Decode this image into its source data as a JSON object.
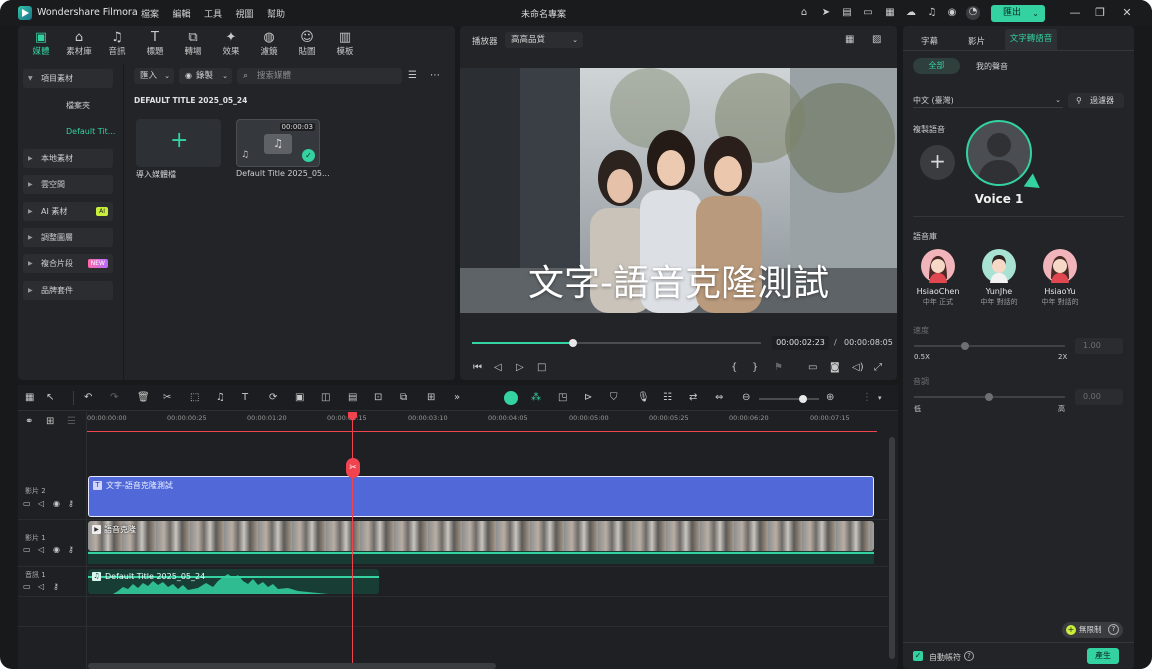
{
  "app": {
    "name": "Wondershare Filmora",
    "document_title": "未命名專案"
  },
  "menu": [
    "檔案",
    "編輯",
    "工具",
    "視圖",
    "幫助"
  ],
  "export_label": "匯出",
  "media_tabs": [
    "媒體",
    "素材庫",
    "音訊",
    "標題",
    "轉場",
    "效果",
    "濾鏡",
    "貼圖",
    "模板"
  ],
  "sidebar": {
    "items": [
      "項目素材",
      "本地素材",
      "雲空間",
      "AI 素材",
      "調整圖層",
      "複合片段",
      "品牌套件"
    ],
    "sub_items": [
      "檔案夾",
      "Default Tit..."
    ],
    "ai_badge": "AI",
    "new_badge": "NEW"
  },
  "media": {
    "import_label": "匯入",
    "record_label": "錄製",
    "search_placeholder": "搜索媒體",
    "section_title": "DEFAULT TITLE 2025_05_24",
    "import_media_label": "導入媒體檔",
    "clip_name": "Default Title 2025_05...",
    "clip_duration": "00:00:03"
  },
  "player": {
    "label": "播放器",
    "quality": "高高品質",
    "overlay_text": "文字-語音克隆測試",
    "current_time": "00:00:02:23",
    "total_time": "00:00:08:05",
    "progress": 0.35
  },
  "right_panel": {
    "tabs": [
      "字幕",
      "影片",
      "文字轉語音"
    ],
    "subtabs": [
      "全部",
      "我的聲音"
    ],
    "language": "中文 (臺灣)",
    "filter_label": "過濾器",
    "clone_label": "複製語音",
    "voice_name": "Voice 1",
    "voice_lib_label": "語音庫",
    "voices": [
      {
        "name": "HsiaoChen",
        "desc": "中年 正式"
      },
      {
        "name": "YunJhe",
        "desc": "中年 對話的"
      },
      {
        "name": "HsiaoYu",
        "desc": "中年 對話的"
      }
    ],
    "speed_label": "速度",
    "speed_min": "0.5X",
    "speed_max": "2X",
    "speed_value": "1.00",
    "pitch_label": "音調",
    "pitch_min": "低",
    "pitch_max": "高",
    "pitch_value": "0.00",
    "unlimited_label": "無限制",
    "auto_subtitle_label": "自動帳符",
    "generate_label": "產生"
  },
  "timeline": {
    "ruler": [
      "00:00:00:00",
      "00:00:00:25",
      "00:00:01:20",
      "00:00:02:15",
      "00:00:03:10",
      "00:00:04:05",
      "00:00:05:00",
      "00:00:05:25",
      "00:00:06:20",
      "00:00:07:15"
    ],
    "tracks": [
      "影片 2",
      "影片 1",
      "音訊 1"
    ],
    "title_clip": "文字-語音克隆測試",
    "video_clip": "語音克隆",
    "audio_clip": "Default Title 2025_05_24"
  },
  "colors": {
    "accent": "#33d2a0",
    "title_clip": "#5068d8",
    "playhead": "#f0434f"
  }
}
